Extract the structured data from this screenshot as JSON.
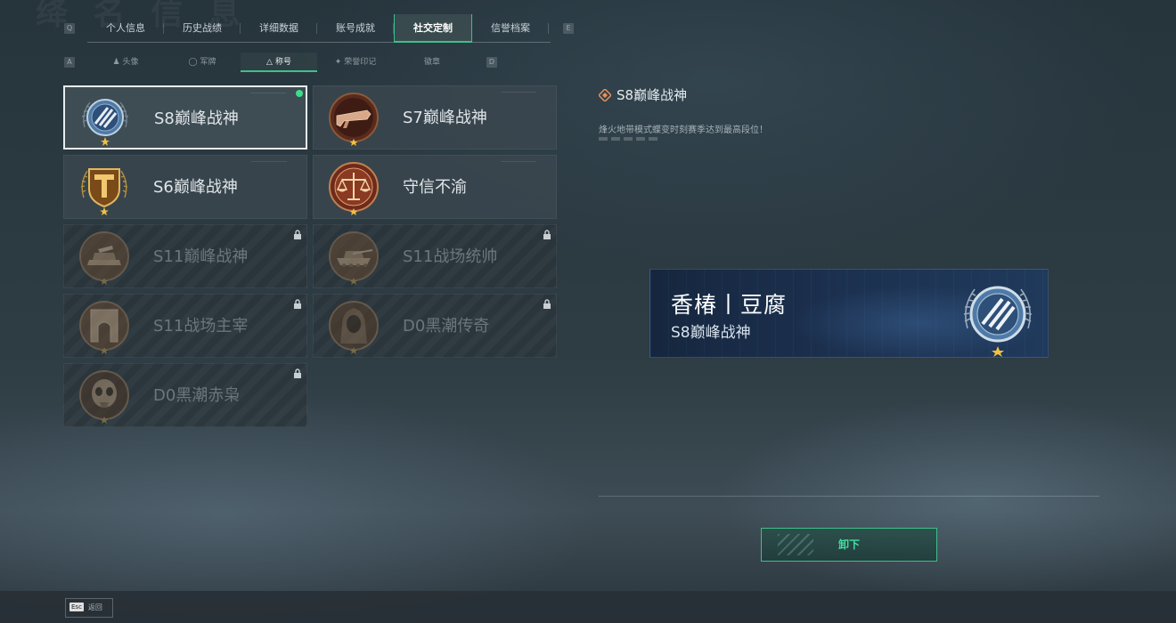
{
  "top_tabs": {
    "prev_key": "Q",
    "next_key": "E",
    "items": [
      {
        "label": "个人信息"
      },
      {
        "label": "历史战绩"
      },
      {
        "label": "详细数据"
      },
      {
        "label": "账号成就"
      },
      {
        "label": "社交定制",
        "active": true
      },
      {
        "label": "信誉档案"
      }
    ]
  },
  "sub_tabs": {
    "prev_key": "A",
    "next_key": "D",
    "items": [
      {
        "label": "头像",
        "icon": "person-icon"
      },
      {
        "label": "军牌",
        "icon": "dogtag-icon"
      },
      {
        "label": "称号",
        "icon": "title-icon",
        "active": true
      },
      {
        "label": "荣誉印记",
        "icon": "honor-icon"
      },
      {
        "label": "徽章",
        "icon": ""
      }
    ]
  },
  "titles": [
    {
      "label": "S8巅峰战神",
      "locked": false,
      "selected": true,
      "equipped": true,
      "badge": "blue-wings-emblem-icon"
    },
    {
      "label": "S7巅峰战神",
      "locked": false,
      "badge": "bronze-weapon-emblem-icon"
    },
    {
      "label": "S6巅峰战神",
      "locked": false,
      "badge": "gold-shield-emblem-icon"
    },
    {
      "label": "守信不渝",
      "locked": false,
      "badge": "scales-emblem-icon"
    },
    {
      "label": "S11巅峰战神",
      "locked": true,
      "badge": "tank-emblem-icon"
    },
    {
      "label": "S11战场统帅",
      "locked": true,
      "badge": "tank-emblem-icon"
    },
    {
      "label": "S11战场主宰",
      "locked": true,
      "badge": "arch-emblem-icon"
    },
    {
      "label": "D0黑潮传奇",
      "locked": true,
      "badge": "hooded-figure-emblem-icon"
    },
    {
      "label": "D0黑潮赤枭",
      "locked": true,
      "badge": "skull-emblem-icon"
    }
  ],
  "detail": {
    "title": "S8巅峰战神",
    "description": "烽火地带模式蝶变时刻赛季达到最高段位！"
  },
  "preview": {
    "player_name": "香椿丨豆腐",
    "title": "S8巅峰战神"
  },
  "actions": {
    "unequip_label": "卸下"
  },
  "footer": {
    "esc_key": "Esc",
    "back_label": "返回"
  },
  "colors": {
    "accent_green": "#3fbf8a",
    "equipped_dot": "#3fdc8c",
    "detail_icon": "#e8925a"
  }
}
